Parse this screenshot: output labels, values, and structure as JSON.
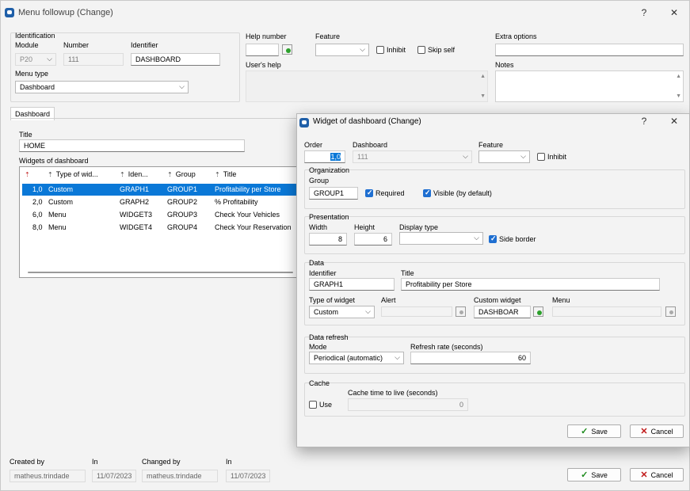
{
  "main": {
    "title": "Menu followup (Change)",
    "help_btn": "?",
    "close_btn": "✕",
    "identification": {
      "section": "Identification",
      "module_label": "Module",
      "module_value": "P20",
      "number_label": "Number",
      "number_value": "111",
      "identifier_label": "Identifier",
      "identifier_value": "DASHBOARD",
      "menu_type_label": "Menu type",
      "menu_type_value": "Dashboard"
    },
    "help_number_label": "Help number",
    "feature_label": "Feature",
    "inhibit_label": "Inhibit",
    "skip_self_label": "Skip self",
    "users_help_label": "User's help",
    "extra_options_label": "Extra options",
    "notes_label": "Notes",
    "tab": "Dashboard",
    "title_label": "Title",
    "title_value": "HOME",
    "widgets_label": "Widgets of dashboard",
    "columns": [
      "",
      "Type of wid...",
      "Iden...",
      "Group",
      "Title"
    ],
    "rows": [
      {
        "order": "1,0",
        "type": "Custom",
        "ident": "GRAPH1",
        "group": "GROUP1",
        "title": "Profitability per Store"
      },
      {
        "order": "2,0",
        "type": "Custom",
        "ident": "GRAPH2",
        "group": "GROUP2",
        "title": "% Profitability"
      },
      {
        "order": "6,0",
        "type": "Menu",
        "ident": "WIDGET3",
        "group": "GROUP3",
        "title": "Check Your Vehicles"
      },
      {
        "order": "8,0",
        "type": "Menu",
        "ident": "WIDGET4",
        "group": "GROUP4",
        "title": "Check Your Reservation"
      }
    ],
    "created_by_label": "Created by",
    "created_by_value": "matheus.trindade",
    "in_label": "In",
    "created_in_value": "11/07/2023",
    "changed_by_label": "Changed by",
    "changed_by_value": "matheus.trindade",
    "changed_in_value": "11/07/2023",
    "save": "Save",
    "cancel": "Cancel"
  },
  "dialog": {
    "title": "Widget of dashboard (Change)",
    "help_btn": "?",
    "close_btn": "✕",
    "order_label": "Order",
    "order_value": "1,0",
    "dashboard_label": "Dashboard",
    "dashboard_value": "111",
    "feature_label": "Feature",
    "inhibit_label": "Inhibit",
    "organization": "Organization",
    "group_label": "Group",
    "group_value": "GROUP1",
    "required_label": "Required",
    "visible_label": "Visible (by default)",
    "presentation": "Presentation",
    "width_label": "Width",
    "width_value": "8",
    "height_label": "Height",
    "height_value": "6",
    "display_type_label": "Display type",
    "side_border_label": "Side border",
    "data": "Data",
    "identifier_label": "Identifier",
    "identifier_value": "GRAPH1",
    "title_label": "Title",
    "title_value": "Profitability per Store",
    "type_label": "Type of widget",
    "type_value": "Custom",
    "alert_label": "Alert",
    "custom_widget_label": "Custom widget",
    "custom_widget_value": "DASHBOAR",
    "menu_label": "Menu",
    "data_refresh": "Data refresh",
    "mode_label": "Mode",
    "mode_value": "Periodical (automatic)",
    "refresh_label": "Refresh rate (seconds)",
    "refresh_value": "60",
    "cache": "Cache",
    "use_label": "Use",
    "cache_ttl_label": "Cache time to live (seconds)",
    "cache_ttl_value": "0",
    "save": "Save",
    "cancel": "Cancel"
  }
}
